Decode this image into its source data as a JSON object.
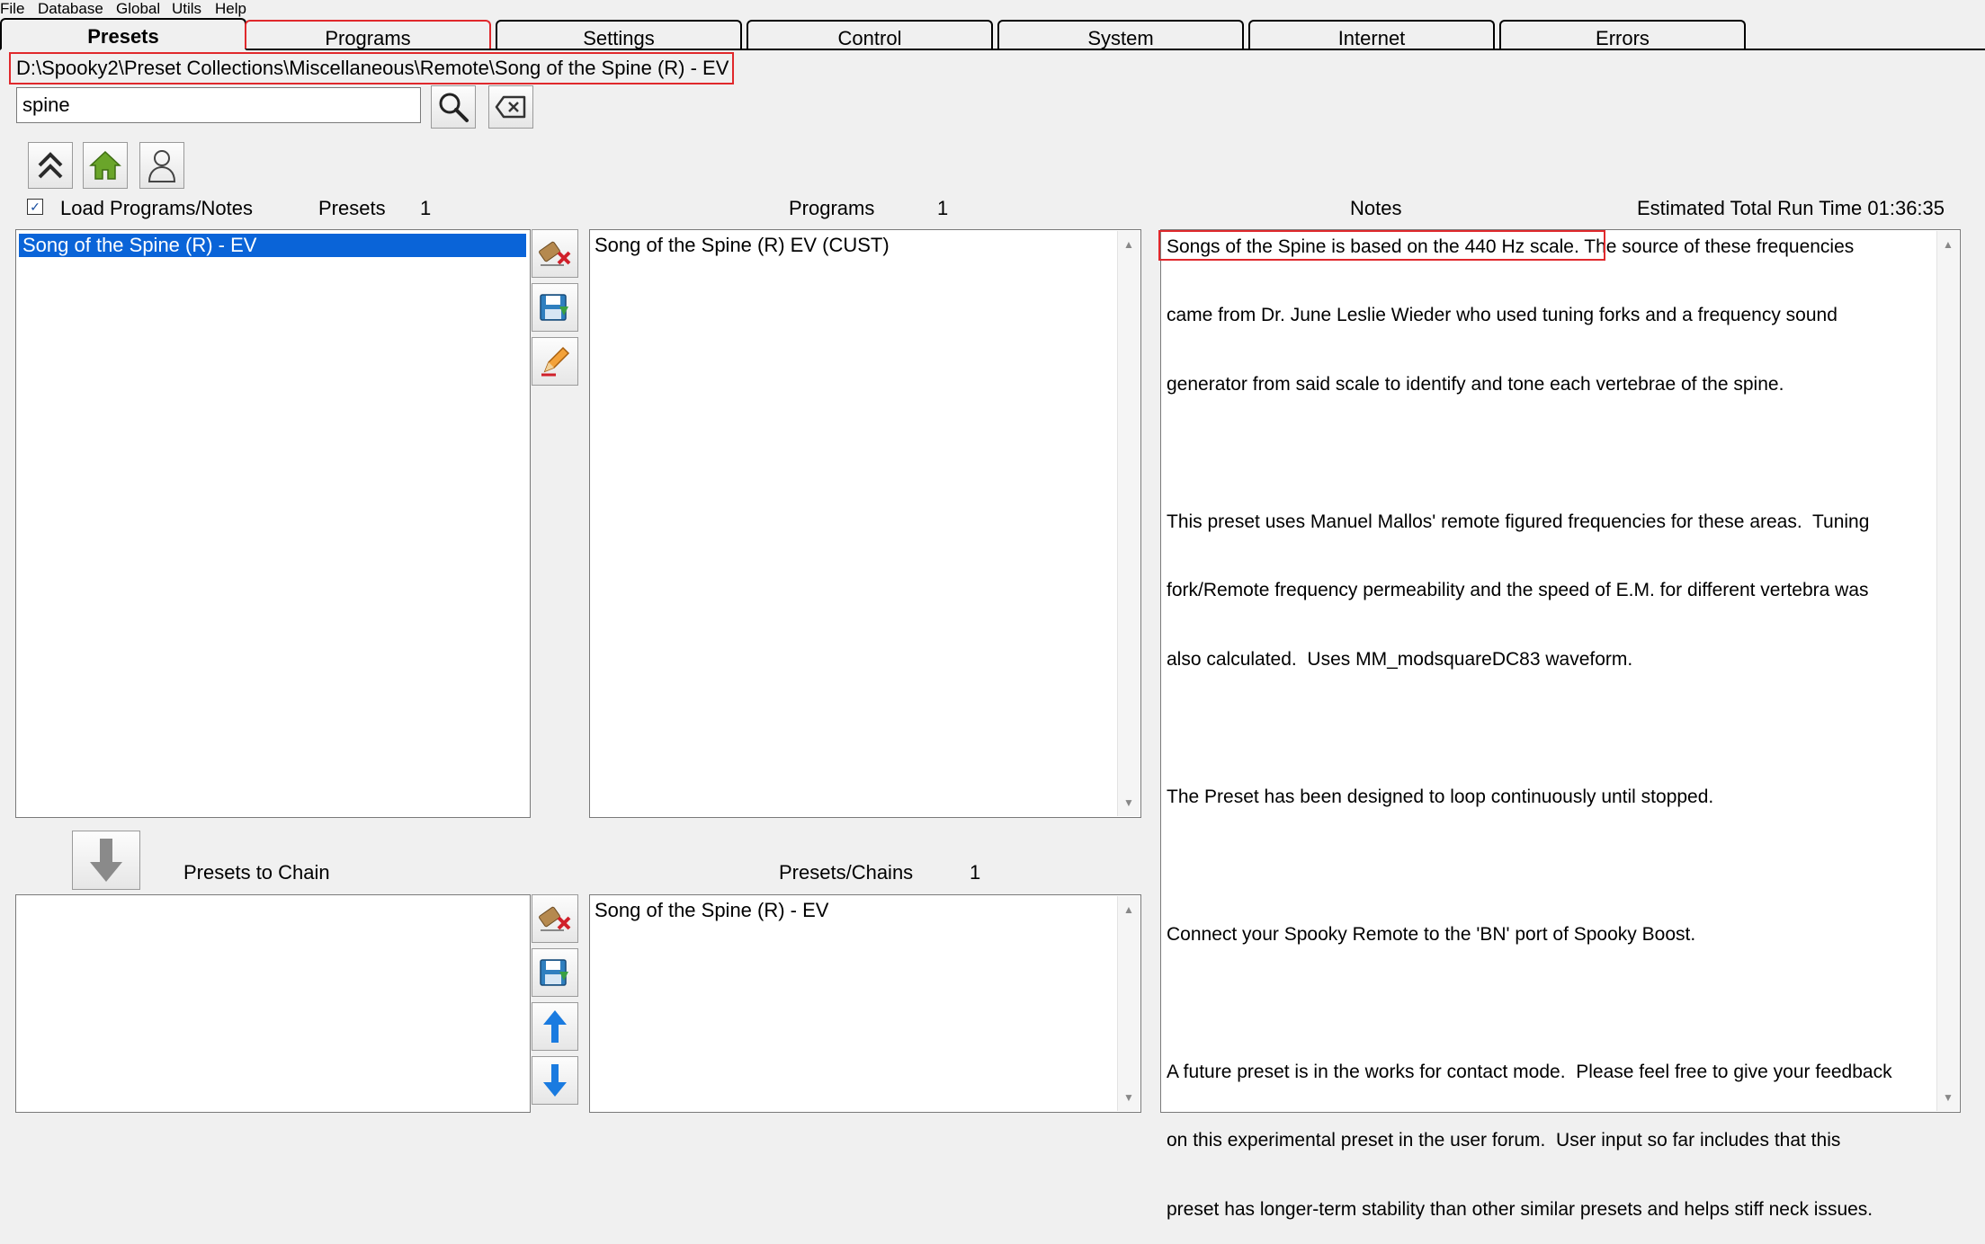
{
  "menu": [
    "File",
    "Database",
    "Global",
    "Utils",
    "Help"
  ],
  "tabs": [
    "Presets",
    "Programs",
    "Settings",
    "Control",
    "System",
    "Internet",
    "Errors"
  ],
  "active_tab": "Presets",
  "path": "D:\\Spooky2\\Preset Collections\\Miscellaneous\\Remote\\Song of the Spine (R) - EV",
  "search": {
    "value": "spine"
  },
  "load_programs_label": "Load Programs/Notes",
  "load_programs_checked": true,
  "presets_header": {
    "label": "Presets",
    "count": "1"
  },
  "programs_header": {
    "label": "Programs",
    "count": "1"
  },
  "notes_header": "Notes",
  "run_time": "Estimated Total Run Time 01:36:35",
  "presets_list": [
    "Song of the Spine (R) - EV"
  ],
  "programs_list": [
    "Song of the Spine (R) EV (CUST)"
  ],
  "presets_to_chain_label": "Presets to Chain",
  "chains_header": {
    "label": "Presets/Chains",
    "count": "1"
  },
  "chains_list": [
    "Song of the Spine (R) - EV"
  ],
  "notes": {
    "highlighted": "Songs of the Spine is based on the 440 Hz scale.",
    "rest_first_line": " The source of these frequencies",
    "lines": [
      "came from Dr. June Leslie Wieder who used tuning forks and a frequency sound",
      "generator from said scale to identify and tone each vertebrae of the spine.",
      "",
      "This preset uses Manuel Mallos' remote figured frequencies for these areas.  Tuning",
      "fork/Remote frequency permeability and the speed of E.M. for different vertebra was",
      "also calculated.  Uses MM_modsquareDC83 waveform.",
      "",
      "The Preset has been designed to loop continuously until stopped.",
      "",
      "Connect your Spooky Remote to the 'BN' port of Spooky Boost.",
      "",
      "A future preset is in the works for contact mode.  Please feel free to give your feedback",
      "on this experimental preset in the user forum.  User input so far includes that this",
      "preset has longer-term stability than other similar presets and helps stiff neck issues."
    ]
  },
  "colors": {
    "selection": "#0a64d8",
    "highlight_box": "#e0282c"
  }
}
